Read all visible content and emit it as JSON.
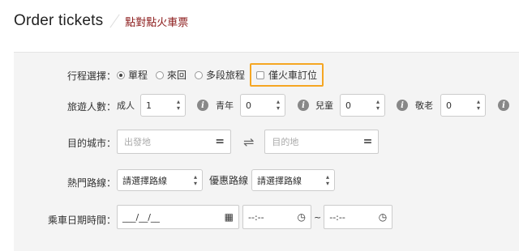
{
  "header": {
    "title": "Order tickets",
    "subtitle": "點對點火車票"
  },
  "trip_type": {
    "label": "行程選擇：",
    "options": [
      "單程",
      "來回",
      "多段旅程"
    ],
    "selected": "單程",
    "train_only_label": "僅火車訂位"
  },
  "passengers": {
    "label": "旅遊人數：",
    "adult_label": "成人",
    "adult_value": "1",
    "youth_label": "青年",
    "youth_value": "0",
    "child_label": "兒童",
    "child_value": "0",
    "senior_label": "敬老",
    "senior_value": "0"
  },
  "destination": {
    "label": "目的城市：",
    "from_placeholder": "出發地",
    "to_placeholder": "目的地"
  },
  "routes": {
    "label": "熱門路線：",
    "popular_value": "請選擇路線",
    "discount_label": "優惠路線",
    "discount_value": "請選擇路線"
  },
  "datetime": {
    "label": "乘車日期時間：",
    "date_value": "___/__/__",
    "time_from_value": "--:--",
    "separator": "~",
    "time_to_value": "--:--"
  }
}
